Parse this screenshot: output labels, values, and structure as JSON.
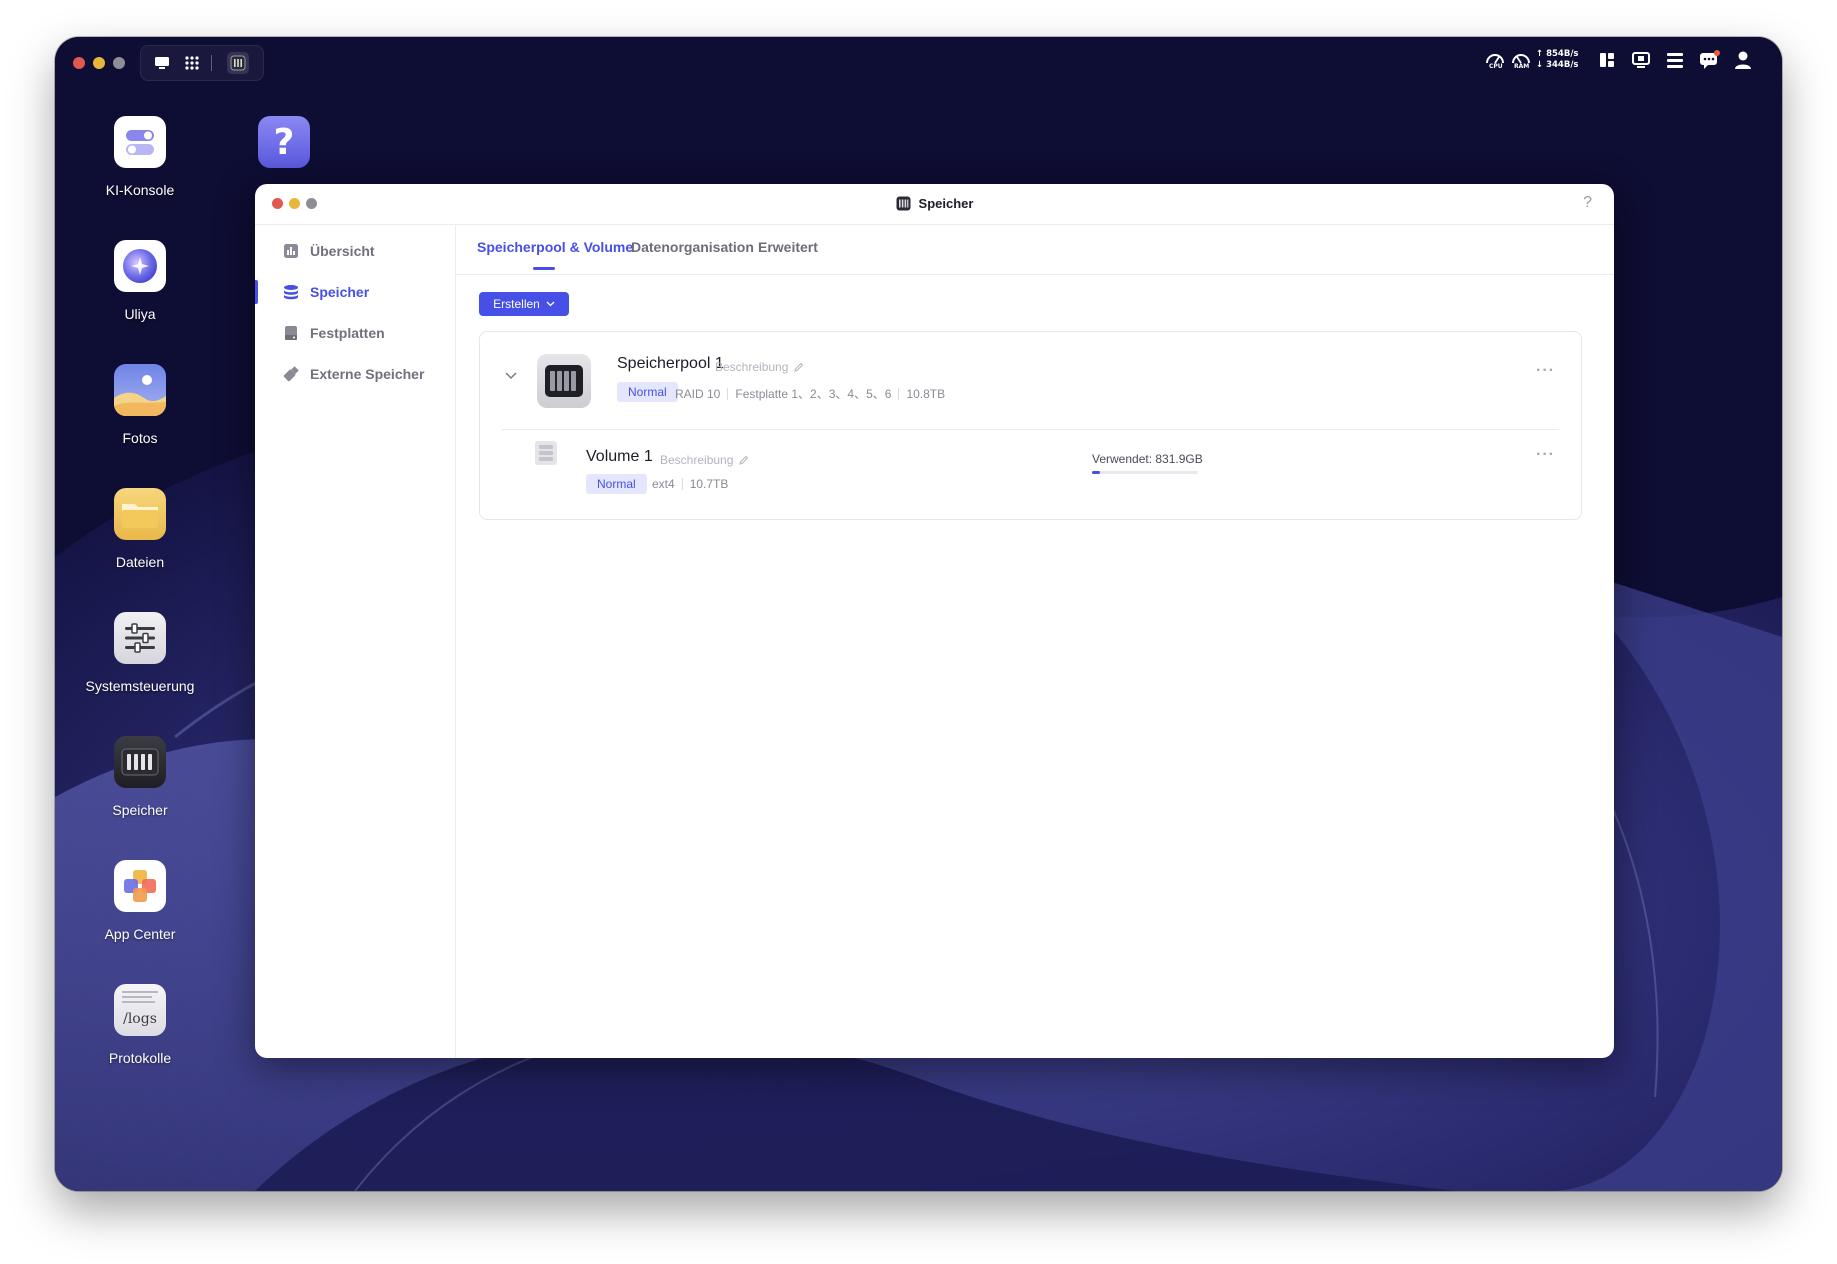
{
  "window": {
    "title": "Speicher",
    "help": "?"
  },
  "desktop": {
    "icons": [
      {
        "label": "KI-Konsole"
      },
      {
        "label": "Uliya"
      },
      {
        "label": "Fotos"
      },
      {
        "label": "Dateien"
      },
      {
        "label": "Systemsteuerung"
      },
      {
        "label": "Speicher"
      },
      {
        "label": "App Center"
      },
      {
        "label": "Protokolle"
      }
    ],
    "help_icon": "?",
    "logs_icon_text": "/logs"
  },
  "tray": {
    "cpu_label": "CPU",
    "ram_label": "RAM",
    "upload": "854B/s",
    "download": "344B/s"
  },
  "sidebar": {
    "items": [
      {
        "label": "Übersicht",
        "icon": "chart-icon"
      },
      {
        "label": "Speicher",
        "icon": "database-icon",
        "active": true
      },
      {
        "label": "Festplatten",
        "icon": "disk-icon"
      },
      {
        "label": "Externe Speicher",
        "icon": "usb-icon"
      }
    ]
  },
  "tabs": [
    {
      "label": "Speicherpool & Volume",
      "active": true
    },
    {
      "label": "Datenorganisation"
    },
    {
      "label": "Erweitert"
    }
  ],
  "toolbar": {
    "create_label": "Erstellen"
  },
  "pool": {
    "name": "Speicherpool 1",
    "description_placeholder": "Beschreibung",
    "status": "Normal",
    "raid": "RAID 10",
    "disks": "Festplatte 1、2、3、4、5、6",
    "capacity": "10.8TB",
    "more": "···"
  },
  "volume": {
    "name": "Volume 1",
    "description_placeholder": "Beschreibung",
    "status": "Normal",
    "filesystem": "ext4",
    "capacity": "10.7TB",
    "used_label": "Verwendet: 831.9GB",
    "used_fraction": 0.076,
    "more": "···"
  },
  "colors": {
    "accent": "#4650e6",
    "badge_bg": "#e3e6fc",
    "desktop_bg": "#0e0d33",
    "close": "#e0584f",
    "minimize": "#e8b73a",
    "zoom": "#8e8e96"
  }
}
